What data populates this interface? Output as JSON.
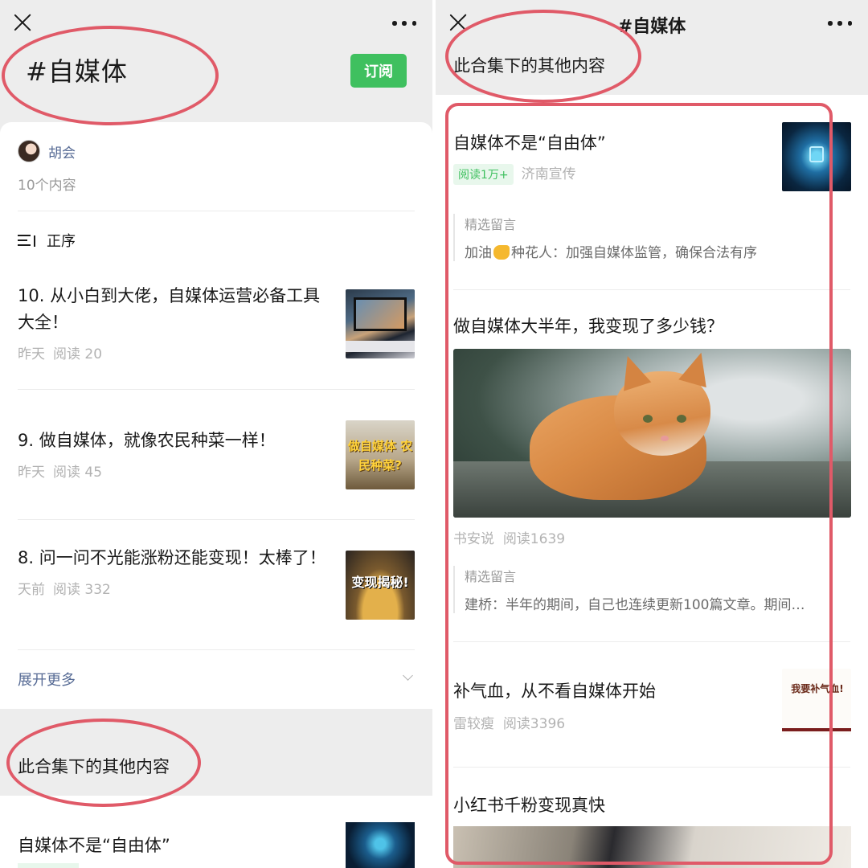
{
  "left": {
    "hashtag_title": "#自媒体",
    "subscribe_label": "订阅",
    "author": "胡会",
    "count_text": "10个内容",
    "sort_label": "正序",
    "items": [
      {
        "title": "10. 从小白到大佬，自媒体运营必备工具大全！",
        "date": "昨天",
        "reads": "阅读 20",
        "thumb_text": ""
      },
      {
        "title": "9. 做自媒体，就像农民种菜一样！",
        "date": "昨天",
        "reads": "阅读 45",
        "thumb_text": "做自媒体 农民种菜?"
      },
      {
        "title": "8. 问一问不光能涨粉还能变现！太棒了！",
        "date": "天前",
        "reads": "阅读 332",
        "thumb_text": "变现揭秘!"
      }
    ],
    "expand_label": "展开更多",
    "other_header": "此合集下的其他内容",
    "bottom_item_title": "自媒体不是“自由体”"
  },
  "right": {
    "page_title": "#自媒体",
    "other_header": "此合集下的其他内容",
    "articles": [
      {
        "title": "自媒体不是“自由体”",
        "read_tag": "阅读1万+",
        "source": "济南宣传",
        "comment_head": "精选留言",
        "comment_user": "加油",
        "comment_rest": "种花人：加强自媒体监管，确保合法有序"
      },
      {
        "title": "做自媒体大半年，我变现了多少钱？",
        "source": "书安说",
        "reads": "阅读1639",
        "comment_head": "精选留言",
        "comment": "建桥：半年的期间，自己也连续更新100篇文章。期间…"
      },
      {
        "title": "补气血，从不看自媒体开始",
        "source": "雷较瘦",
        "reads": "阅读3396",
        "thumb_text": "我要补气血!"
      },
      {
        "title": "小红书千粉变现真快"
      }
    ]
  },
  "colors": {
    "accent_green": "#3fc05f",
    "link_blue": "#576b95",
    "annotation_red": "#e05a68"
  },
  "icons": [
    "close-icon",
    "more-icon",
    "sort-icon",
    "chevron-down-icon"
  ]
}
